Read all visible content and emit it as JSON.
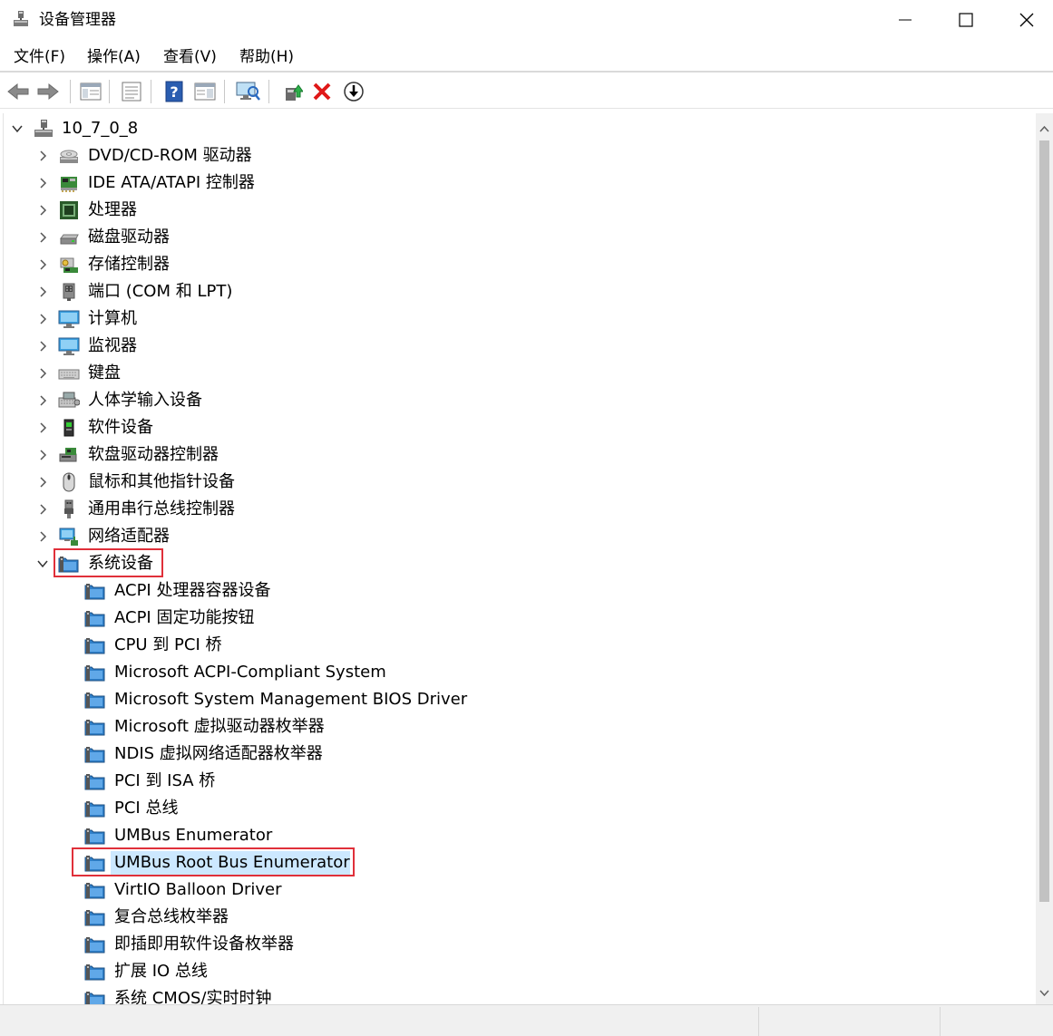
{
  "window": {
    "title": "设备管理器"
  },
  "menubar": {
    "items": [
      "文件(F)",
      "操作(A)",
      "查看(V)",
      "帮助(H)"
    ]
  },
  "toolbar": {
    "buttons": [
      "back-icon",
      "forward-icon",
      "properties-window-icon",
      "list-view-icon",
      "help-icon",
      "view-details-icon",
      "scan-hardware-icon",
      "update-driver-icon",
      "uninstall-icon",
      "download-icon"
    ]
  },
  "colors": {
    "highlight_border": "#e0303a",
    "selection": "#cce8ff",
    "folder_blue": "#2f7fc8"
  },
  "tree": {
    "root": {
      "label": "10_7_0_8",
      "icon": "computer-network-icon"
    },
    "categories": [
      {
        "label": "DVD/CD-ROM 驱动器",
        "icon": "dvd-drive-icon"
      },
      {
        "label": "IDE ATA/ATAPI 控制器",
        "icon": "ide-controller-icon"
      },
      {
        "label": "处理器",
        "icon": "processor-icon"
      },
      {
        "label": "磁盘驱动器",
        "icon": "disk-drive-icon"
      },
      {
        "label": "存储控制器",
        "icon": "storage-controller-icon"
      },
      {
        "label": "端口 (COM 和 LPT)",
        "icon": "port-icon"
      },
      {
        "label": "计算机",
        "icon": "monitor-icon"
      },
      {
        "label": "监视器",
        "icon": "monitor-icon"
      },
      {
        "label": "键盘",
        "icon": "keyboard-icon"
      },
      {
        "label": "人体学输入设备",
        "icon": "hid-icon"
      },
      {
        "label": "软件设备",
        "icon": "software-device-icon"
      },
      {
        "label": "软盘驱动器控制器",
        "icon": "floppy-controller-icon"
      },
      {
        "label": "鼠标和其他指针设备",
        "icon": "mouse-icon"
      },
      {
        "label": "通用串行总线控制器",
        "icon": "usb-icon"
      },
      {
        "label": "网络适配器",
        "icon": "network-adapter-icon"
      },
      {
        "label": "系统设备",
        "icon": "system-folder-icon",
        "expanded": true,
        "highlighted": true
      }
    ],
    "system_devices": [
      {
        "label": "ACPI 处理器容器设备"
      },
      {
        "label": "ACPI 固定功能按钮"
      },
      {
        "label": "CPU 到 PCI 桥"
      },
      {
        "label": "Microsoft ACPI-Compliant System"
      },
      {
        "label": "Microsoft System Management BIOS Driver"
      },
      {
        "label": "Microsoft 虚拟驱动器枚举器"
      },
      {
        "label": "NDIS 虚拟网络适配器枚举器"
      },
      {
        "label": "PCI 到 ISA 桥"
      },
      {
        "label": "PCI 总线"
      },
      {
        "label": "UMBus Enumerator"
      },
      {
        "label": "UMBus Root Bus Enumerator",
        "selected": true,
        "highlighted": true
      },
      {
        "label": "VirtIO Balloon Driver"
      },
      {
        "label": "复合总线枚举器"
      },
      {
        "label": "即插即用软件设备枚举器"
      },
      {
        "label": "扩展 IO 总线"
      },
      {
        "label": "系统 CMOS/实时时钟"
      }
    ]
  }
}
